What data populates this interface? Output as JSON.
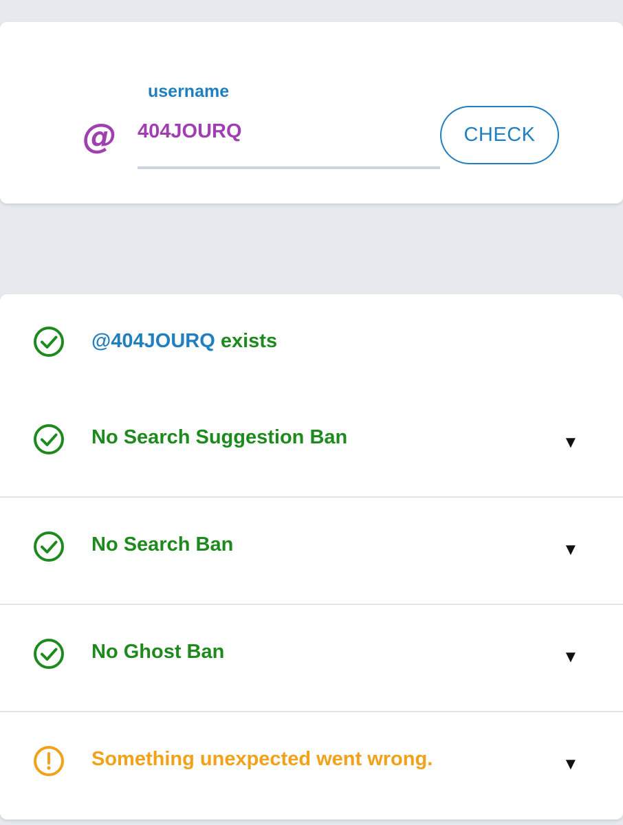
{
  "search": {
    "at_symbol": "@",
    "label": "username",
    "value": "404JOURQ",
    "button_label": "CHECK"
  },
  "results": {
    "exists": {
      "handle": "@404JOURQ",
      "suffix": " exists"
    },
    "items": [
      {
        "label": "No Search Suggestion Ban",
        "status": "ok",
        "icon": "check-circle-icon"
      },
      {
        "label": "No Search Ban",
        "status": "ok",
        "icon": "check-circle-icon"
      },
      {
        "label": "No Ghost Ban",
        "status": "ok",
        "icon": "check-circle-icon"
      },
      {
        "label": "Something unexpected went wrong.",
        "status": "warning",
        "icon": "exclamation-circle-icon"
      }
    ],
    "expand_glyph": "▼"
  },
  "colors": {
    "background": "#e6e9ed",
    "ok": "#1e8a1e",
    "warning": "#f2a11a",
    "accent": "#1f7fc0",
    "handle": "#a040b0"
  }
}
